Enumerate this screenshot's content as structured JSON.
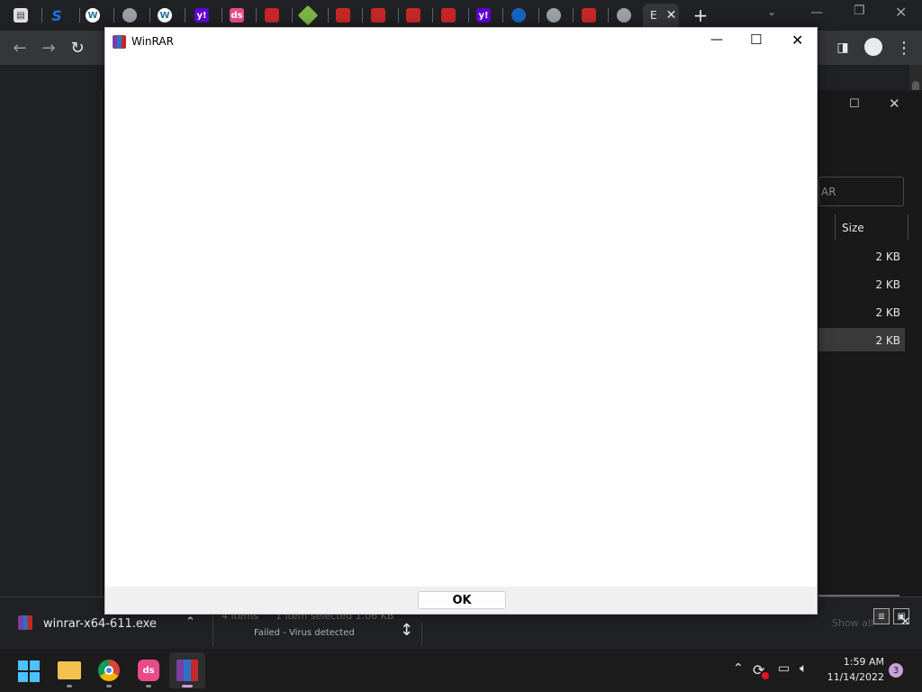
{
  "winrar": {
    "title": "WinRAR",
    "ok_label": "OK"
  },
  "browser": {
    "tab_partial_label": "E",
    "new_tab": "+"
  },
  "explorer": {
    "search_placeholder_partial": "AR",
    "size_header": "Size",
    "sizes": [
      "2 KB",
      "2 KB",
      "2 KB",
      "2 KB"
    ],
    "status_items": "4 items",
    "status_selected": "1 item selected  1.06 KB"
  },
  "download": {
    "filename": "winrar-x64-611.exe",
    "status": "Failed - Virus detected",
    "show_all": "Show all"
  },
  "taskbar": {
    "time": "1:59 AM",
    "date": "11/14/2022",
    "notifications": "3"
  },
  "colors": {
    "accent": "#0078d4",
    "notification_badge": "#c9a0dc"
  }
}
